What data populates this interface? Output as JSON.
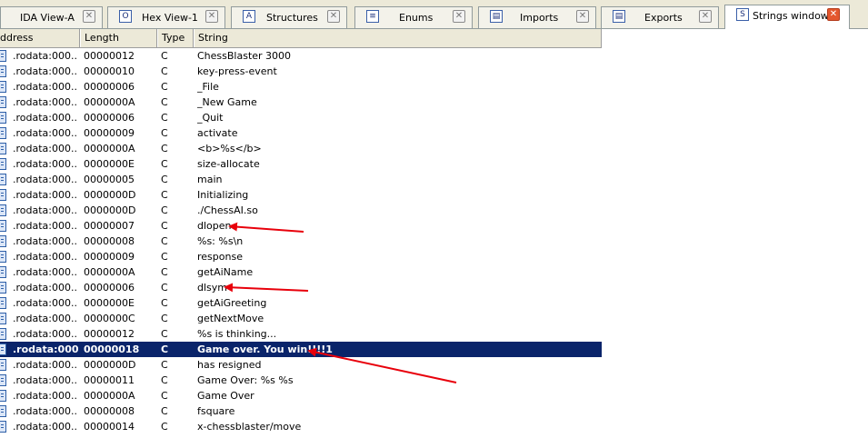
{
  "tabs": [
    {
      "label": "IDA View-A",
      "icon": "ida-view-icon",
      "glyph": "",
      "active": false
    },
    {
      "label": "Hex View-1",
      "icon": "hex-view-icon",
      "glyph": "O",
      "active": false
    },
    {
      "label": "Structures",
      "icon": "structures-icon",
      "glyph": "A",
      "active": false
    },
    {
      "label": "Enums",
      "icon": "enums-icon",
      "glyph": "≡",
      "active": false
    },
    {
      "label": "Imports",
      "icon": "imports-icon",
      "glyph": "▤",
      "active": false
    },
    {
      "label": "Exports",
      "icon": "exports-icon",
      "glyph": "▤",
      "active": false
    },
    {
      "label": "Strings window",
      "icon": "strings-window-icon",
      "glyph": "S",
      "active": true
    }
  ],
  "columns": {
    "address": "ddress",
    "length": "Length",
    "type": "Type",
    "string": "String"
  },
  "rows": [
    {
      "address": ".rodata:000...",
      "length": "00000012",
      "type": "C",
      "string": "ChessBlaster 3000"
    },
    {
      "address": ".rodata:000...",
      "length": "00000010",
      "type": "C",
      "string": "key-press-event"
    },
    {
      "address": ".rodata:000...",
      "length": "00000006",
      "type": "C",
      "string": "_File"
    },
    {
      "address": ".rodata:000...",
      "length": "0000000A",
      "type": "C",
      "string": "_New Game"
    },
    {
      "address": ".rodata:000...",
      "length": "00000006",
      "type": "C",
      "string": "_Quit"
    },
    {
      "address": ".rodata:000...",
      "length": "00000009",
      "type": "C",
      "string": "activate"
    },
    {
      "address": ".rodata:000...",
      "length": "0000000A",
      "type": "C",
      "string": "<b>%s</b>"
    },
    {
      "address": ".rodata:000...",
      "length": "0000000E",
      "type": "C",
      "string": "size-allocate"
    },
    {
      "address": ".rodata:000...",
      "length": "00000005",
      "type": "C",
      "string": "main"
    },
    {
      "address": ".rodata:000...",
      "length": "0000000D",
      "type": "C",
      "string": "Initializing"
    },
    {
      "address": ".rodata:000...",
      "length": "0000000D",
      "type": "C",
      "string": "./ChessAI.so"
    },
    {
      "address": ".rodata:000...",
      "length": "00000007",
      "type": "C",
      "string": "dlopen"
    },
    {
      "address": ".rodata:000...",
      "length": "00000008",
      "type": "C",
      "string": "%s: %s\\n"
    },
    {
      "address": ".rodata:000...",
      "length": "00000009",
      "type": "C",
      "string": "response"
    },
    {
      "address": ".rodata:000...",
      "length": "0000000A",
      "type": "C",
      "string": "getAiName"
    },
    {
      "address": ".rodata:000...",
      "length": "00000006",
      "type": "C",
      "string": "dlsym"
    },
    {
      "address": ".rodata:000...",
      "length": "0000000E",
      "type": "C",
      "string": "getAiGreeting"
    },
    {
      "address": ".rodata:000...",
      "length": "0000000C",
      "type": "C",
      "string": "getNextMove"
    },
    {
      "address": ".rodata:000...",
      "length": "00000012",
      "type": "C",
      "string": "%s is thinking..."
    },
    {
      "address": ".rodata:000...",
      "length": "00000018",
      "type": "C",
      "string": "Game over. You win!!!!1",
      "selected": true
    },
    {
      "address": ".rodata:000...",
      "length": "0000000D",
      "type": "C",
      "string": "has resigned"
    },
    {
      "address": ".rodata:000...",
      "length": "00000011",
      "type": "C",
      "string": "Game Over: %s %s"
    },
    {
      "address": ".rodata:000...",
      "length": "0000000A",
      "type": "C",
      "string": "Game Over"
    },
    {
      "address": ".rodata:000...",
      "length": "00000008",
      "type": "C",
      "string": "fsquare"
    },
    {
      "address": ".rodata:000...",
      "length": "00000014",
      "type": "C",
      "string": "x-chessblaster/move"
    }
  ],
  "annotation_color": "#e8000b",
  "selection_color": "#0a246a"
}
